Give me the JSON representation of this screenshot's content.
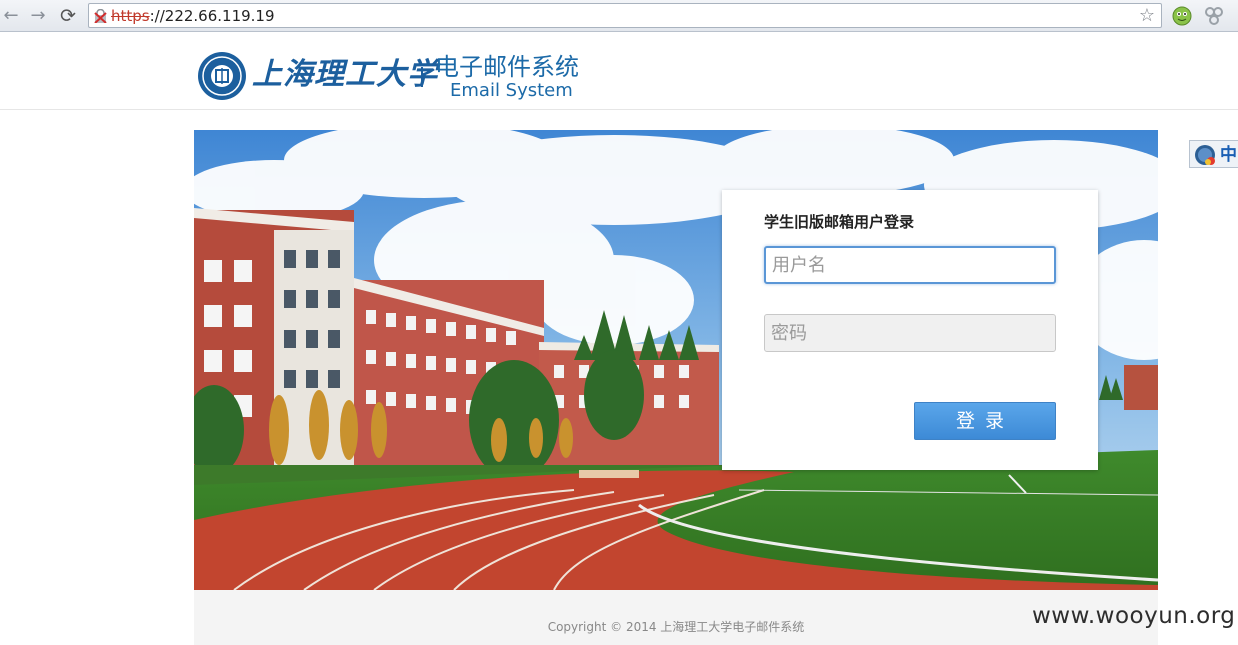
{
  "browser": {
    "back_glyph": "←",
    "forward_glyph": "→",
    "reload_glyph": "⟳",
    "url_scheme": "https",
    "url_rest": "://222.66.119.19",
    "star_glyph": "☆",
    "icons": [
      "back-icon",
      "forward-icon",
      "reload-icon",
      "broken-lock-icon",
      "bookmark-star-icon",
      "extension-face-icon",
      "extension-puzzle-icon"
    ]
  },
  "header": {
    "school_name": "上海理工大学",
    "system_name_cn": "电子邮件系统",
    "system_name_en": "Email System",
    "brand_color": "#1c5f9e"
  },
  "login": {
    "title": "学生旧版邮箱用户登录",
    "username_placeholder": "用户名",
    "password_placeholder": "密码",
    "submit_label": "登录",
    "button_color": "#4796e0"
  },
  "side_widget": {
    "text": "中"
  },
  "footer": {
    "copyright": "Copyright © 2014 上海理工大学电子邮件系统"
  },
  "watermark": "www.wooyun.org"
}
